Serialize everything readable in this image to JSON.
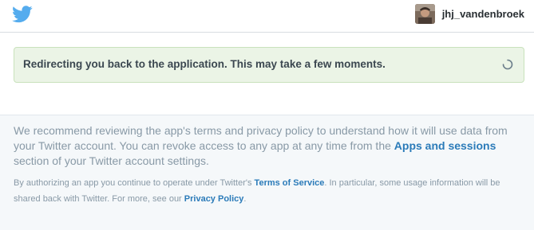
{
  "header": {
    "logo_icon": "twitter-bird-icon",
    "username": "jhj_vandenbroek",
    "brand_color": "#55acee"
  },
  "notice": {
    "message": "Redirecting you back to the application. This may take a few moments.",
    "spinner_icon": "loading-spinner-icon"
  },
  "terms": {
    "text_before": "We recommend reviewing the app's terms and privacy policy to understand how it will use data from your Twitter account. You can revoke access to any app at any time from the ",
    "apps_link": "Apps and sessions",
    "text_after": " section of your Twitter account settings."
  },
  "fine_print": {
    "text_before": "By authorizing an app you continue to operate under Twitter's ",
    "tos_link": "Terms of Service",
    "text_middle": ". In particular, some usage information will be shared back with Twitter. For more, see our ",
    "privacy_link": "Privacy Policy",
    "text_after": "."
  }
}
